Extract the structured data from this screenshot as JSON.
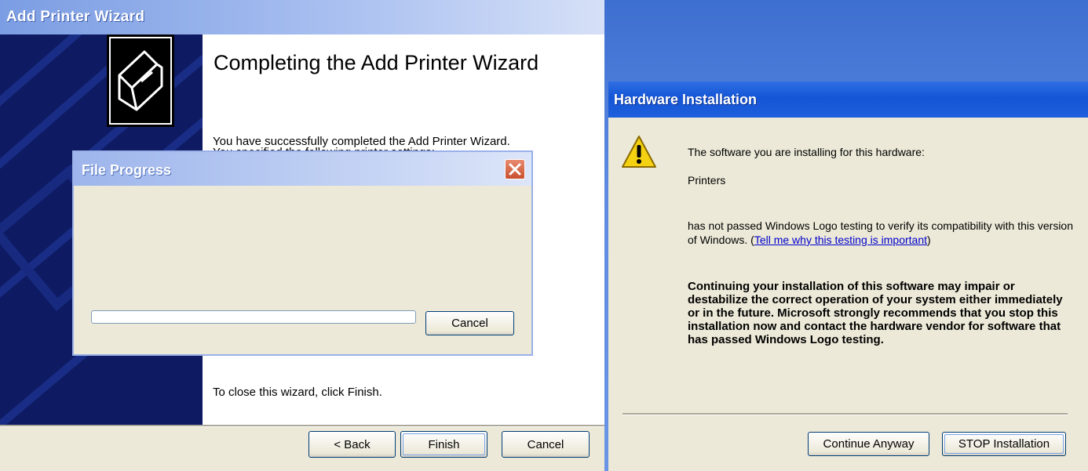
{
  "wizard": {
    "title": "Add Printer Wizard",
    "heading": "Completing the Add Printer Wizard",
    "text_success": "You have successfully completed the Add Printer Wizard.",
    "text_partial": "You specified the following printer settings:",
    "text_close": "To close this wizard, click Finish.",
    "icon": "printer-icon",
    "buttons": {
      "back": "< Back",
      "finish": "Finish",
      "cancel": "Cancel"
    }
  },
  "file_progress": {
    "title": "File Progress",
    "progress": 0,
    "cancel": "Cancel",
    "close_icon": "close-icon"
  },
  "hardware": {
    "title": "Hardware Installation",
    "warning_icon": "warning-icon",
    "text_software": "The software you are installing for this hardware:",
    "device": "Printers",
    "text_logo": "has not passed Windows Logo testing to verify its compatibility with this version of Windows.",
    "link": "Tell me why this testing is important",
    "warning_bold": "Continuing your installation of this software may impair or destabilize the correct operation of your system either immediately or in the future. Microsoft strongly recommends that you stop this installation now and contact the hardware vendor for software that has passed Windows Logo testing.",
    "buttons": {
      "continue": "Continue Anyway",
      "stop": "STOP Installation"
    }
  },
  "colors": {
    "xp_blue_title": "#1455d6",
    "wizard_sidebar": "#0e1b63",
    "dialog_face": "#ece9d8",
    "link": "#0000cc"
  }
}
